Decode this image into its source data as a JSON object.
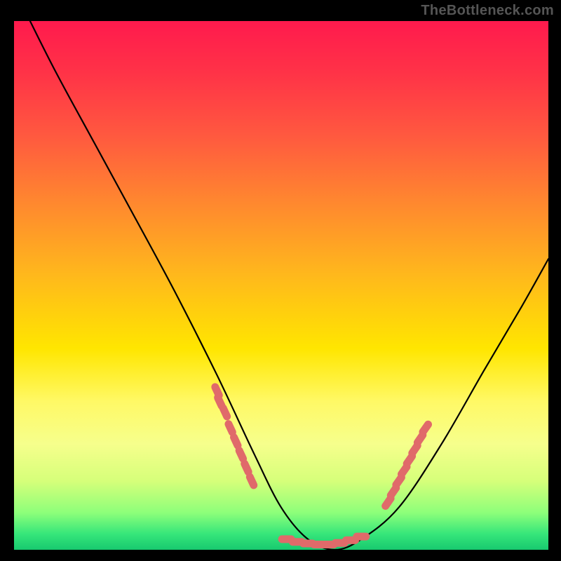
{
  "watermark": "TheBottleneck.com",
  "chart_data": {
    "type": "line",
    "title": "",
    "xlabel": "",
    "ylabel": "",
    "xlim": [
      0,
      100
    ],
    "ylim": [
      0,
      100
    ],
    "gradient_stops": [
      {
        "pos": 0,
        "color": "#ff1a4d"
      },
      {
        "pos": 10,
        "color": "#ff3347"
      },
      {
        "pos": 22,
        "color": "#ff5a3f"
      },
      {
        "pos": 35,
        "color": "#ff8a2e"
      },
      {
        "pos": 48,
        "color": "#ffb81c"
      },
      {
        "pos": 62,
        "color": "#ffe600"
      },
      {
        "pos": 72,
        "color": "#fff966"
      },
      {
        "pos": 80,
        "color": "#f6ff8c"
      },
      {
        "pos": 87,
        "color": "#d6ff7a"
      },
      {
        "pos": 93,
        "color": "#8dff7a"
      },
      {
        "pos": 97,
        "color": "#36e67a"
      },
      {
        "pos": 100,
        "color": "#18c96f"
      }
    ],
    "series": [
      {
        "name": "main-curve",
        "x": [
          3,
          8,
          15,
          22,
          30,
          38,
          45,
          50,
          55,
          60,
          65,
          72,
          80,
          88,
          95,
          100
        ],
        "values": [
          100,
          90,
          77,
          64,
          49,
          33,
          18,
          8,
          2,
          0,
          2,
          8,
          20,
          34,
          46,
          55
        ]
      }
    ],
    "highlight_clusters": [
      {
        "name": "left-cluster",
        "color": "#e06a6a",
        "points": [
          {
            "x": 38.0,
            "y": 30.0
          },
          {
            "x": 38.5,
            "y": 28.0
          },
          {
            "x": 39.5,
            "y": 26.0
          },
          {
            "x": 40.5,
            "y": 23.0
          },
          {
            "x": 41.5,
            "y": 20.5
          },
          {
            "x": 42.5,
            "y": 18.0
          },
          {
            "x": 43.5,
            "y": 15.5
          },
          {
            "x": 44.5,
            "y": 13.0
          }
        ]
      },
      {
        "name": "bottom-cluster",
        "color": "#e06a6a",
        "points": [
          {
            "x": 51.0,
            "y": 2.0
          },
          {
            "x": 53.0,
            "y": 1.5
          },
          {
            "x": 55.0,
            "y": 1.2
          },
          {
            "x": 57.0,
            "y": 1.0
          },
          {
            "x": 59.0,
            "y": 1.0
          },
          {
            "x": 61.0,
            "y": 1.3
          },
          {
            "x": 63.0,
            "y": 1.8
          },
          {
            "x": 65.0,
            "y": 2.5
          }
        ]
      },
      {
        "name": "right-cluster",
        "color": "#e06a6a",
        "points": [
          {
            "x": 70.0,
            "y": 9.0
          },
          {
            "x": 71.0,
            "y": 11.0
          },
          {
            "x": 72.0,
            "y": 13.0
          },
          {
            "x": 73.0,
            "y": 15.0
          },
          {
            "x": 74.0,
            "y": 17.0
          },
          {
            "x": 75.0,
            "y": 19.0
          },
          {
            "x": 76.0,
            "y": 21.0
          },
          {
            "x": 77.0,
            "y": 23.0
          }
        ]
      }
    ]
  }
}
